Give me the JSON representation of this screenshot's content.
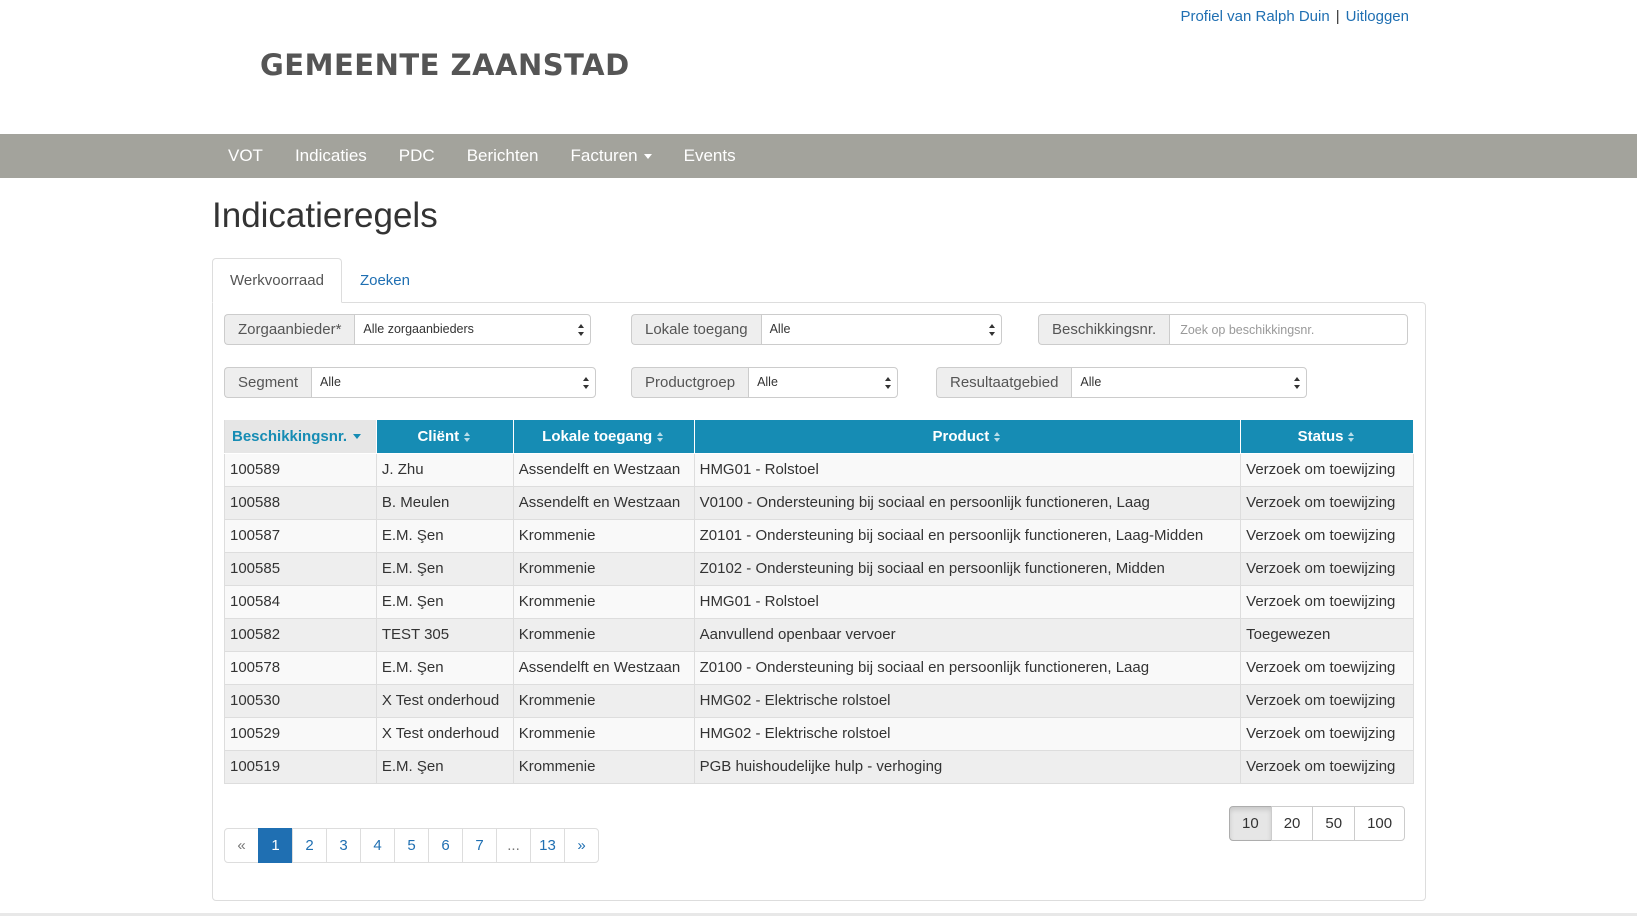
{
  "header": {
    "profile_link": "Profiel van Ralph Duin",
    "separator": "|",
    "logout_link": "Uitloggen",
    "brand": "GEMEENTE ZAANSTAD"
  },
  "nav": {
    "items": [
      "VOT",
      "Indicaties",
      "PDC",
      "Berichten",
      "Facturen",
      "Events"
    ]
  },
  "page": {
    "title": "Indicatieregels"
  },
  "tabs": [
    {
      "label": "Werkvoorraad",
      "active": true
    },
    {
      "label": "Zoeken",
      "active": false
    }
  ],
  "filters": {
    "zorgaanbieder": {
      "label": "Zorgaanbieder*",
      "value": "Alle zorgaanbieders"
    },
    "lokale_toegang": {
      "label": "Lokale toegang",
      "value": "Alle"
    },
    "beschikkingsnr": {
      "label": "Beschikkingsnr.",
      "placeholder": "Zoek op beschikkingsnr."
    },
    "segment": {
      "label": "Segment",
      "value": "Alle"
    },
    "productgroep": {
      "label": "Productgroep",
      "value": "Alle"
    },
    "resultaatgebied": {
      "label": "Resultaatgebied",
      "value": "Alle"
    }
  },
  "table": {
    "columns": [
      "Beschikkingsnr.",
      "Cliënt",
      "Lokale toegang",
      "Product",
      "Status"
    ],
    "rows": [
      [
        "100589",
        "J. Zhu",
        "Assendelft en Westzaan",
        "HMG01 - Rolstoel",
        "Verzoek om toewijzing"
      ],
      [
        "100588",
        "B. Meulen",
        "Assendelft en Westzaan",
        "V0100 - Ondersteuning bij sociaal en persoonlijk functioneren, Laag",
        "Verzoek om toewijzing"
      ],
      [
        "100587",
        "E.M. Şen",
        "Krommenie",
        "Z0101 - Ondersteuning bij sociaal en persoonlijk functioneren, Laag-Midden",
        "Verzoek om toewijzing"
      ],
      [
        "100585",
        "E.M. Şen",
        "Krommenie",
        "Z0102 - Ondersteuning bij sociaal en persoonlijk functioneren, Midden",
        "Verzoek om toewijzing"
      ],
      [
        "100584",
        "E.M. Şen",
        "Krommenie",
        "HMG01 - Rolstoel",
        "Verzoek om toewijzing"
      ],
      [
        "100582",
        "TEST 305",
        "Krommenie",
        "Aanvullend openbaar vervoer",
        "Toegewezen"
      ],
      [
        "100578",
        "E.M. Şen",
        "Assendelft en Westzaan",
        "Z0100 - Ondersteuning bij sociaal en persoonlijk functioneren, Laag",
        "Verzoek om toewijzing"
      ],
      [
        "100530",
        "X Test onderhoud",
        "Krommenie",
        "HMG02 - Elektrische rolstoel",
        "Verzoek om toewijzing"
      ],
      [
        "100529",
        "X Test onderhoud",
        "Krommenie",
        "HMG02 - Elektrische rolstoel",
        "Verzoek om toewijzing"
      ],
      [
        "100519",
        "E.M. Şen",
        "Krommenie",
        "PGB huishoudelijke hulp - verhoging",
        "Verzoek om toewijzing"
      ]
    ]
  },
  "pagination": {
    "prev": "«",
    "pages": [
      "1",
      "2",
      "3",
      "4",
      "5",
      "6",
      "7",
      "...",
      "13"
    ],
    "current": "1",
    "next": "»"
  },
  "page_size": {
    "options": [
      "10",
      "20",
      "50",
      "100"
    ],
    "selected": "10"
  },
  "colors": {
    "navbar": "#a3a39c",
    "table_header": "#168cb4",
    "link": "#1f6fb2"
  }
}
